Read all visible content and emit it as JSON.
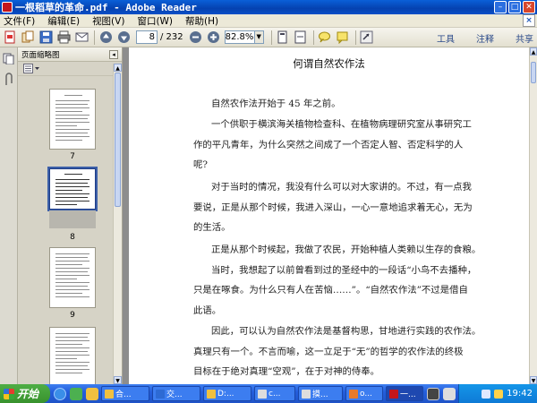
{
  "window": {
    "title": "一根稻草的革命.pdf - Adobe Reader"
  },
  "menu": [
    "文件(F)",
    "编辑(E)",
    "视图(V)",
    "窗口(W)",
    "帮助(H)"
  ],
  "toolbar": {
    "current_page": "8",
    "total_pages": "/ 232",
    "zoom": "82.8%",
    "right_links": [
      "工具",
      "注释",
      "共享"
    ]
  },
  "sidebar": {
    "panel_title": "页面缩略图",
    "thumbnails": [
      {
        "label": "7",
        "selected": false
      },
      {
        "label": "8",
        "selected": true
      },
      {
        "label": "9",
        "selected": false
      },
      {
        "label": "",
        "selected": false
      }
    ]
  },
  "document": {
    "title": "何谓自然农作法",
    "lines": [
      "自然农作法开始于 45 年之前。",
      "一个供职于横滨海关植物检查科、在植物病理研究室从事研究工",
      "作的平凡青年，为什么突然之间成了一个否定人智、否定科学的人",
      "呢?",
      "对于当时的情况，我没有什么可以对大家讲的。不过，有一点我",
      "要说，正是从那个时候，我进入深山，一心一意地追求着无心，无为",
      "的生活。",
      "正是从那个时候起，我做了农民，开始种植人类赖以生存的食粮。",
      "当时，我想起了以前曾看到过的圣经中的一段话“小鸟不去播种，",
      "只是在啄食。为什么只有人在苦恼……”。“自然农作法”不过是借自",
      "此语。",
      "因此，可以认为自然农作法是基督构思，甘地进行实践的农作法。",
      "真理只有一个。不言而喻，这一立足于“无”的哲学的农作法的终极",
      "目标在于绝对真理“空观”，在于对神的侍奉。"
    ]
  },
  "taskbar": {
    "start_label": "开始",
    "tasks": [
      "合...",
      "交...",
      "D:...",
      "c...",
      "摸...",
      "o...",
      "一..."
    ],
    "clock": "19:42"
  },
  "colors": {
    "titlebar": "#0a4fc8",
    "start": "#38922d",
    "doc_background": "#8d8d8d"
  }
}
